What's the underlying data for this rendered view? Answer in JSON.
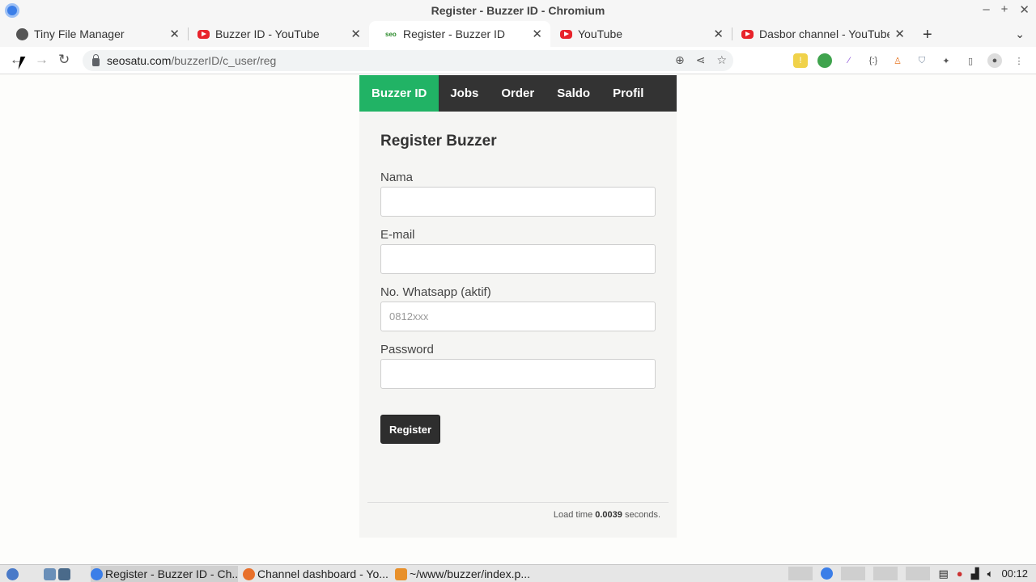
{
  "window": {
    "title": "Register - Buzzer ID - Chromium"
  },
  "tabs": [
    {
      "label": "Tiny File Manager",
      "favicon": "globe-icon"
    },
    {
      "label": "Buzzer ID - YouTube",
      "favicon": "youtube-icon"
    },
    {
      "label": "Register - Buzzer ID",
      "favicon": "seo-icon",
      "favicon_text": "seo"
    },
    {
      "label": "YouTube",
      "favicon": "youtube-icon"
    },
    {
      "label": "Dasbor channel - YouTube",
      "favicon": "youtube-icon"
    }
  ],
  "address": {
    "host": "seosatu.com",
    "path": "/buzzerID/c_user/reg"
  },
  "nav": {
    "brand": "Buzzer ID",
    "items": [
      "Jobs",
      "Order",
      "Saldo",
      "Profil"
    ]
  },
  "form": {
    "heading": "Register Buzzer",
    "fields": [
      {
        "label": "Nama",
        "value": "",
        "placeholder": ""
      },
      {
        "label": "E-mail",
        "value": "",
        "placeholder": ""
      },
      {
        "label": "No. Whatsapp (aktif)",
        "value": "",
        "placeholder": "0812xxx"
      },
      {
        "label": "Password",
        "value": "",
        "placeholder": ""
      }
    ],
    "submit_label": "Register"
  },
  "footer": {
    "prefix": "Load time",
    "value": "0.0039",
    "suffix": "seconds."
  },
  "taskbar": {
    "tasks": [
      "Register - Buzzer ID - Ch...",
      "Channel dashboard - Yo...",
      "~/www/buzzer/index.p..."
    ],
    "clock": "00:12"
  },
  "colors": {
    "brand": "#21b365",
    "navbar": "#333333",
    "youtube": "#e8232b"
  }
}
